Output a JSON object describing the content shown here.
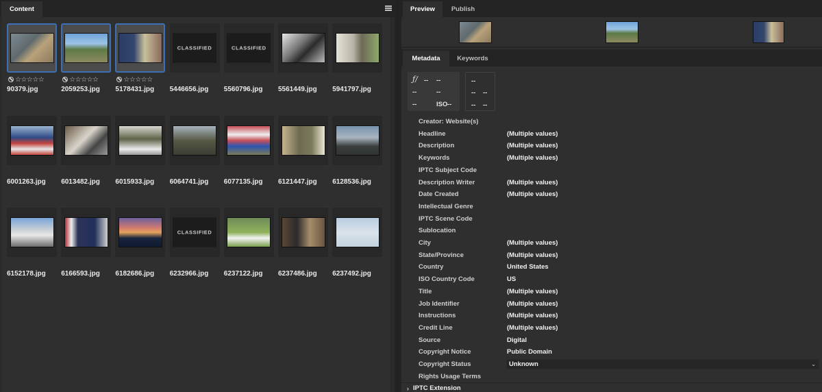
{
  "content_panel": {
    "tab_label": "Content",
    "menu_icon": "hamburger-menu-icon",
    "thumbnails": [
      {
        "filename": "90379.jpg",
        "selected": true,
        "rating": "☆☆☆☆☆",
        "rejected_icon": "reject-icon",
        "style": "p1"
      },
      {
        "filename": "2059253.jpg",
        "selected": true,
        "rating": "☆☆☆☆☆",
        "rejected_icon": "reject-icon",
        "style": "p2"
      },
      {
        "filename": "5178431.jpg",
        "selected": true,
        "rating": "☆☆☆☆☆",
        "rejected_icon": "reject-icon",
        "style": "p3"
      },
      {
        "filename": "5446656.jpg",
        "selected": false,
        "overlay": "CLASSIFIED"
      },
      {
        "filename": "5560796.jpg",
        "selected": false,
        "overlay": "CLASSIFIED"
      },
      {
        "filename": "5561449.jpg",
        "selected": false,
        "style": "p4"
      },
      {
        "filename": "5941797.jpg",
        "selected": false,
        "style": "p5"
      },
      {
        "filename": "6001263.jpg",
        "selected": false,
        "style": "p6"
      },
      {
        "filename": "6013482.jpg",
        "selected": false,
        "style": "p7"
      },
      {
        "filename": "6015933.jpg",
        "selected": false,
        "style": "p8"
      },
      {
        "filename": "6064741.jpg",
        "selected": false,
        "style": "p9"
      },
      {
        "filename": "6077135.jpg",
        "selected": false,
        "style": "p10"
      },
      {
        "filename": "6121447.jpg",
        "selected": false,
        "style": "p11"
      },
      {
        "filename": "6128536.jpg",
        "selected": false,
        "style": "p12"
      },
      {
        "filename": "6152178.jpg",
        "selected": false,
        "style": "p13"
      },
      {
        "filename": "6166593.jpg",
        "selected": false,
        "style": "p14"
      },
      {
        "filename": "6182686.jpg",
        "selected": false,
        "style": "p15"
      },
      {
        "filename": "6232966.jpg",
        "selected": false,
        "overlay": "CLASSIFIED"
      },
      {
        "filename": "6237122.jpg",
        "selected": false,
        "style": "p16"
      },
      {
        "filename": "6237486.jpg",
        "selected": false,
        "style": "p17"
      },
      {
        "filename": "6237492.jpg",
        "selected": false,
        "style": "p18"
      }
    ]
  },
  "preview_panel": {
    "tabs": [
      {
        "label": "Preview",
        "active": true
      },
      {
        "label": "Publish",
        "active": false
      }
    ],
    "previews": [
      "90379.jpg",
      "2059253.jpg",
      "5178431.jpg"
    ]
  },
  "metadata_panel": {
    "tabs": [
      {
        "label": "Metadata",
        "active": true
      },
      {
        "label": "Keywords",
        "active": false
      }
    ],
    "exif": {
      "aperture_prefix": "ƒ/",
      "aperture": "--",
      "shutter": "--",
      "r2c1": "--",
      "r2c2": "--",
      "r3c1": "--",
      "iso_label": "ISO",
      "iso": "--",
      "box2_r1": "--",
      "box2_r2c1": "--",
      "box2_r2c2": "--",
      "box2_r3c1": "--",
      "box2_r3c2": "--"
    },
    "fields": [
      {
        "label": "Creator: Website(s)",
        "value": ""
      },
      {
        "label": "Headline",
        "value": "(Multiple values)"
      },
      {
        "label": "Description",
        "value": "(Multiple values)"
      },
      {
        "label": "Keywords",
        "value": "(Multiple values)"
      },
      {
        "label": "IPTC Subject Code",
        "value": ""
      },
      {
        "label": "Description Writer",
        "value": "(Multiple values)"
      },
      {
        "label": "Date Created",
        "value": "(Multiple values)"
      },
      {
        "label": "Intellectual Genre",
        "value": ""
      },
      {
        "label": "IPTC Scene Code",
        "value": ""
      },
      {
        "label": "Sublocation",
        "value": ""
      },
      {
        "label": "City",
        "value": "(Multiple values)"
      },
      {
        "label": "State/Province",
        "value": "(Multiple values)"
      },
      {
        "label": "Country",
        "value": "United States"
      },
      {
        "label": "ISO Country Code",
        "value": "US"
      },
      {
        "label": "Title",
        "value": "(Multiple values)"
      },
      {
        "label": "Job Identifier",
        "value": "(Multiple values)"
      },
      {
        "label": "Instructions",
        "value": "(Multiple values)"
      },
      {
        "label": "Credit Line",
        "value": "(Multiple values)"
      },
      {
        "label": "Source",
        "value": "Digital"
      },
      {
        "label": "Copyright Notice",
        "value": "Public Domain"
      },
      {
        "label": "Copyright Status",
        "value": "Unknown",
        "type": "select"
      },
      {
        "label": "Rights Usage Terms",
        "value": ""
      }
    ],
    "collapsed_section": {
      "label": "IPTC Extension",
      "icon": "chevron-right-icon"
    }
  },
  "colors": {
    "selection_border": "#3d6fb8",
    "panel_bg": "#2f2f2f",
    "tabbar_bg": "#232323"
  }
}
